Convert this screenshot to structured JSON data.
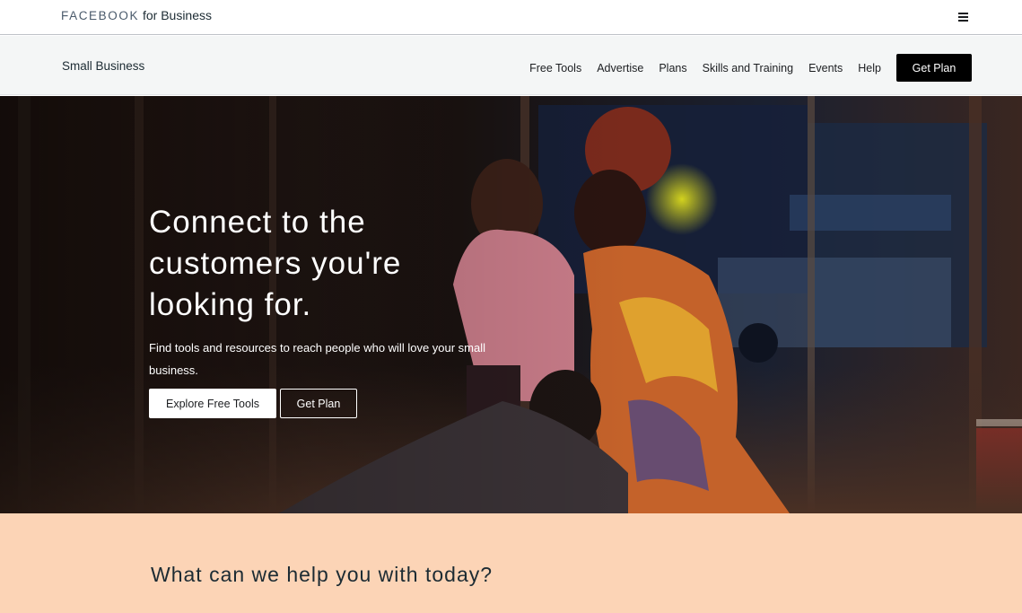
{
  "topbar": {
    "brand_primary": "FACEBOOK",
    "brand_secondary": " for Business",
    "menu_icon": "hamburger-menu-icon"
  },
  "subnav": {
    "title": "Small Business",
    "links": [
      "Free Tools",
      "Advertise",
      "Plans",
      "Skills and Training",
      "Events",
      "Help"
    ],
    "cta": "Get Plan"
  },
  "hero": {
    "title_lines": [
      "Connect to the",
      "customers you're",
      "looking for."
    ],
    "subtitle": "Find tools and resources to reach people who will love your small business.",
    "primary_button": "Explore Free Tools",
    "secondary_button": "Get Plan",
    "image": "photo-of-two-women-in-hair-salon"
  },
  "help": {
    "title": "What can we help you with today?"
  },
  "colors": {
    "cta_black": "#000000",
    "subnav_bg": "#f4f6f6",
    "help_bg": "#fcd4b6"
  }
}
